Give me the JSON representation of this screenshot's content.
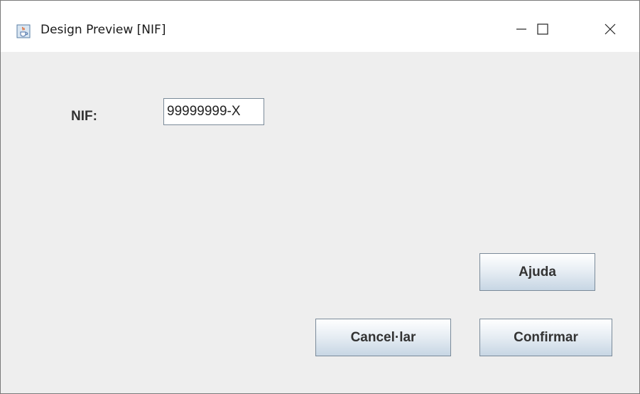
{
  "window": {
    "title": "Design Preview [NIF]",
    "app_icon": "java-cup-icon",
    "controls": {
      "minimize_icon": "minimize-icon",
      "maximize_icon": "maximize-icon",
      "close_icon": "close-icon"
    }
  },
  "form": {
    "nif_label": "NIF:",
    "nif_value": "99999999-X"
  },
  "buttons": {
    "help_label": "Ajuda",
    "cancel_label": "Cancel·lar",
    "confirm_label": "Confirmar"
  },
  "colors": {
    "background": "#eeeeee",
    "titlebar": "#ffffff",
    "button_border": "#7a8a99"
  }
}
